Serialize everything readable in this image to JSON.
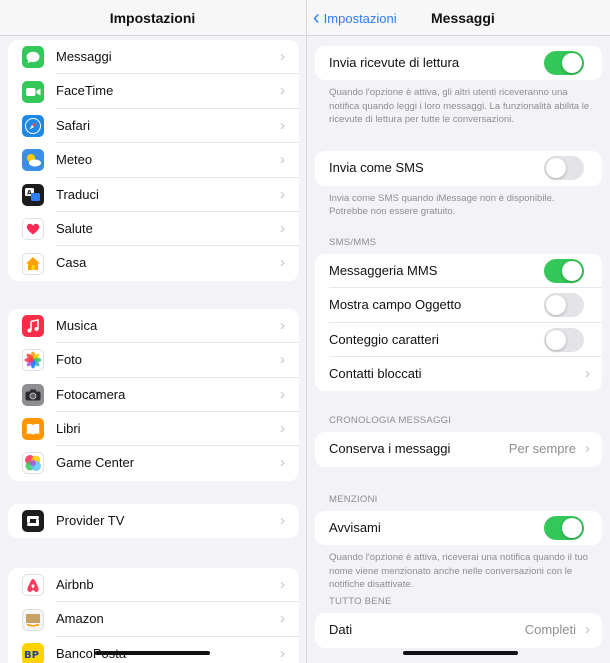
{
  "left": {
    "title": "Impostazioni",
    "groups": [
      [
        {
          "label": "Messaggi",
          "icon": "messages-icon",
          "color": "#34c759"
        },
        {
          "label": "FaceTime",
          "icon": "facetime-icon",
          "color": "#34c759"
        },
        {
          "label": "Safari",
          "icon": "safari-icon",
          "color": "#1e88e5"
        },
        {
          "label": "Meteo",
          "icon": "weather-icon",
          "color": "#3a8ee6"
        },
        {
          "label": "Traduci",
          "icon": "translate-icon",
          "color": "#1c1c1e"
        },
        {
          "label": "Salute",
          "icon": "health-icon",
          "color": "#ffffff"
        },
        {
          "label": "Casa",
          "icon": "home-icon",
          "color": "#ffffff"
        }
      ],
      [
        {
          "label": "Musica",
          "icon": "music-icon",
          "color": "#fa2d48"
        },
        {
          "label": "Foto",
          "icon": "photos-icon",
          "color": "#ffffff"
        },
        {
          "label": "Fotocamera",
          "icon": "camera-icon",
          "color": "#8e8e93"
        },
        {
          "label": "Libri",
          "icon": "books-icon",
          "color": "#ff9500"
        },
        {
          "label": "Game Center",
          "icon": "game-center-icon",
          "color": "#ffffff"
        }
      ],
      [
        {
          "label": "Provider TV",
          "icon": "tv-provider-icon",
          "color": "#1c1c1e"
        }
      ],
      [
        {
          "label": "Airbnb",
          "icon": "airbnb-icon",
          "color": "#ffffff"
        },
        {
          "label": "Amazon",
          "icon": "amazon-icon",
          "color": "#f5f5f5"
        },
        {
          "label": "BancoPosta",
          "icon": "bancoposta-icon",
          "color": "#ffd200"
        }
      ]
    ],
    "icon_glyphs": {
      "tv": "S",
      "bancoposta": "BP"
    }
  },
  "right": {
    "back_label": "Impostazioni",
    "title": "Messaggi",
    "read_receipts": {
      "label": "Invia ricevute di lettura",
      "on": true,
      "footnote": "Quando l'opzione è attiva, gli altri utenti riceveranno una notifica quando leggi i loro messaggi. La funzionalità abilita le ricevute di lettura per tutte le conversazioni."
    },
    "send_sms": {
      "label": "Invia come SMS",
      "on": false,
      "footnote": "Invia come SMS quando iMessage non è disponibile. Potrebbe non essere gratuito."
    },
    "sms_mms": {
      "header": "SMS/MMS",
      "mms": {
        "label": "Messaggeria MMS",
        "on": true
      },
      "subject": {
        "label": "Mostra campo Oggetto",
        "on": false
      },
      "char_count": {
        "label": "Conteggio caratteri",
        "on": false
      },
      "blocked": {
        "label": "Contatti bloccati"
      }
    },
    "history": {
      "header": "CRONOLOGIA MESSAGGI",
      "keep": {
        "label": "Conserva i messaggi",
        "value": "Per sempre"
      }
    },
    "mentions": {
      "header": "MENZIONI",
      "notify": {
        "label": "Avvisami",
        "on": true,
        "footnote": "Quando l'opzione è attiva, riceverai una notifica quando il tuo nome viene menzionato anche nelle conversazioni con le notifiche disattivate."
      }
    },
    "all_good": {
      "header": "TUTTO BENE",
      "data": {
        "label": "Dati",
        "value": "Completi"
      }
    }
  }
}
